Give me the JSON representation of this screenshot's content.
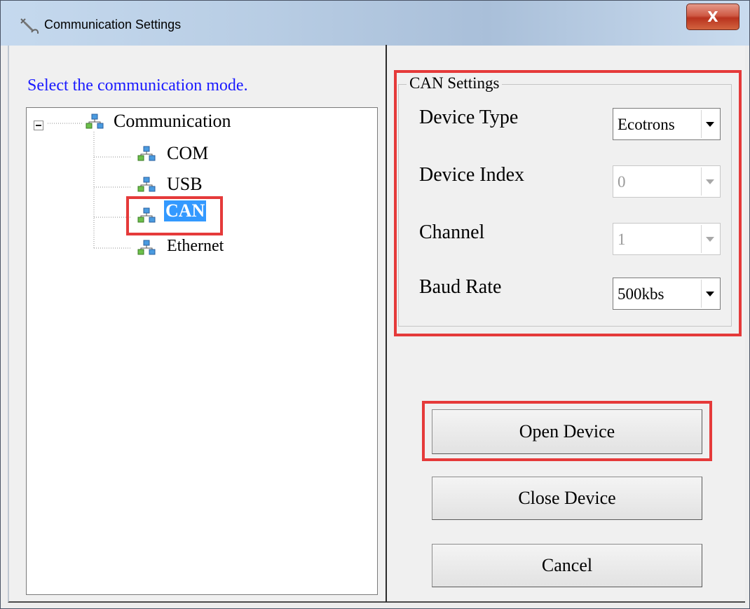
{
  "window": {
    "title": "Communication Settings",
    "close_label": "X"
  },
  "left_pane": {
    "prompt": "Select the communication mode.",
    "tree": {
      "root_label": "Communication",
      "children": [
        "COM",
        "USB",
        "CAN",
        "Ethernet"
      ],
      "selected": "CAN"
    }
  },
  "can_settings": {
    "group_title": "CAN Settings",
    "device_type": {
      "label": "Device Type",
      "value": "Ecotrons",
      "enabled": true
    },
    "device_index": {
      "label": "Device Index",
      "value": "0",
      "enabled": false
    },
    "channel": {
      "label": "Channel",
      "value": "1",
      "enabled": false
    },
    "baud_rate": {
      "label": "Baud Rate",
      "value": "500kbs",
      "enabled": true
    }
  },
  "buttons": {
    "open": "Open Device",
    "close": "Close Device",
    "cancel": "Cancel"
  },
  "colors": {
    "highlight": "#e53a3a",
    "prompt_text": "#1a1aff",
    "selection": "#3399ff"
  },
  "icons": {
    "app": "network-wrench-icon",
    "tree_node": "network-icon",
    "expand": "collapse-minus-icon",
    "dropdown": "chevron-down-icon"
  }
}
